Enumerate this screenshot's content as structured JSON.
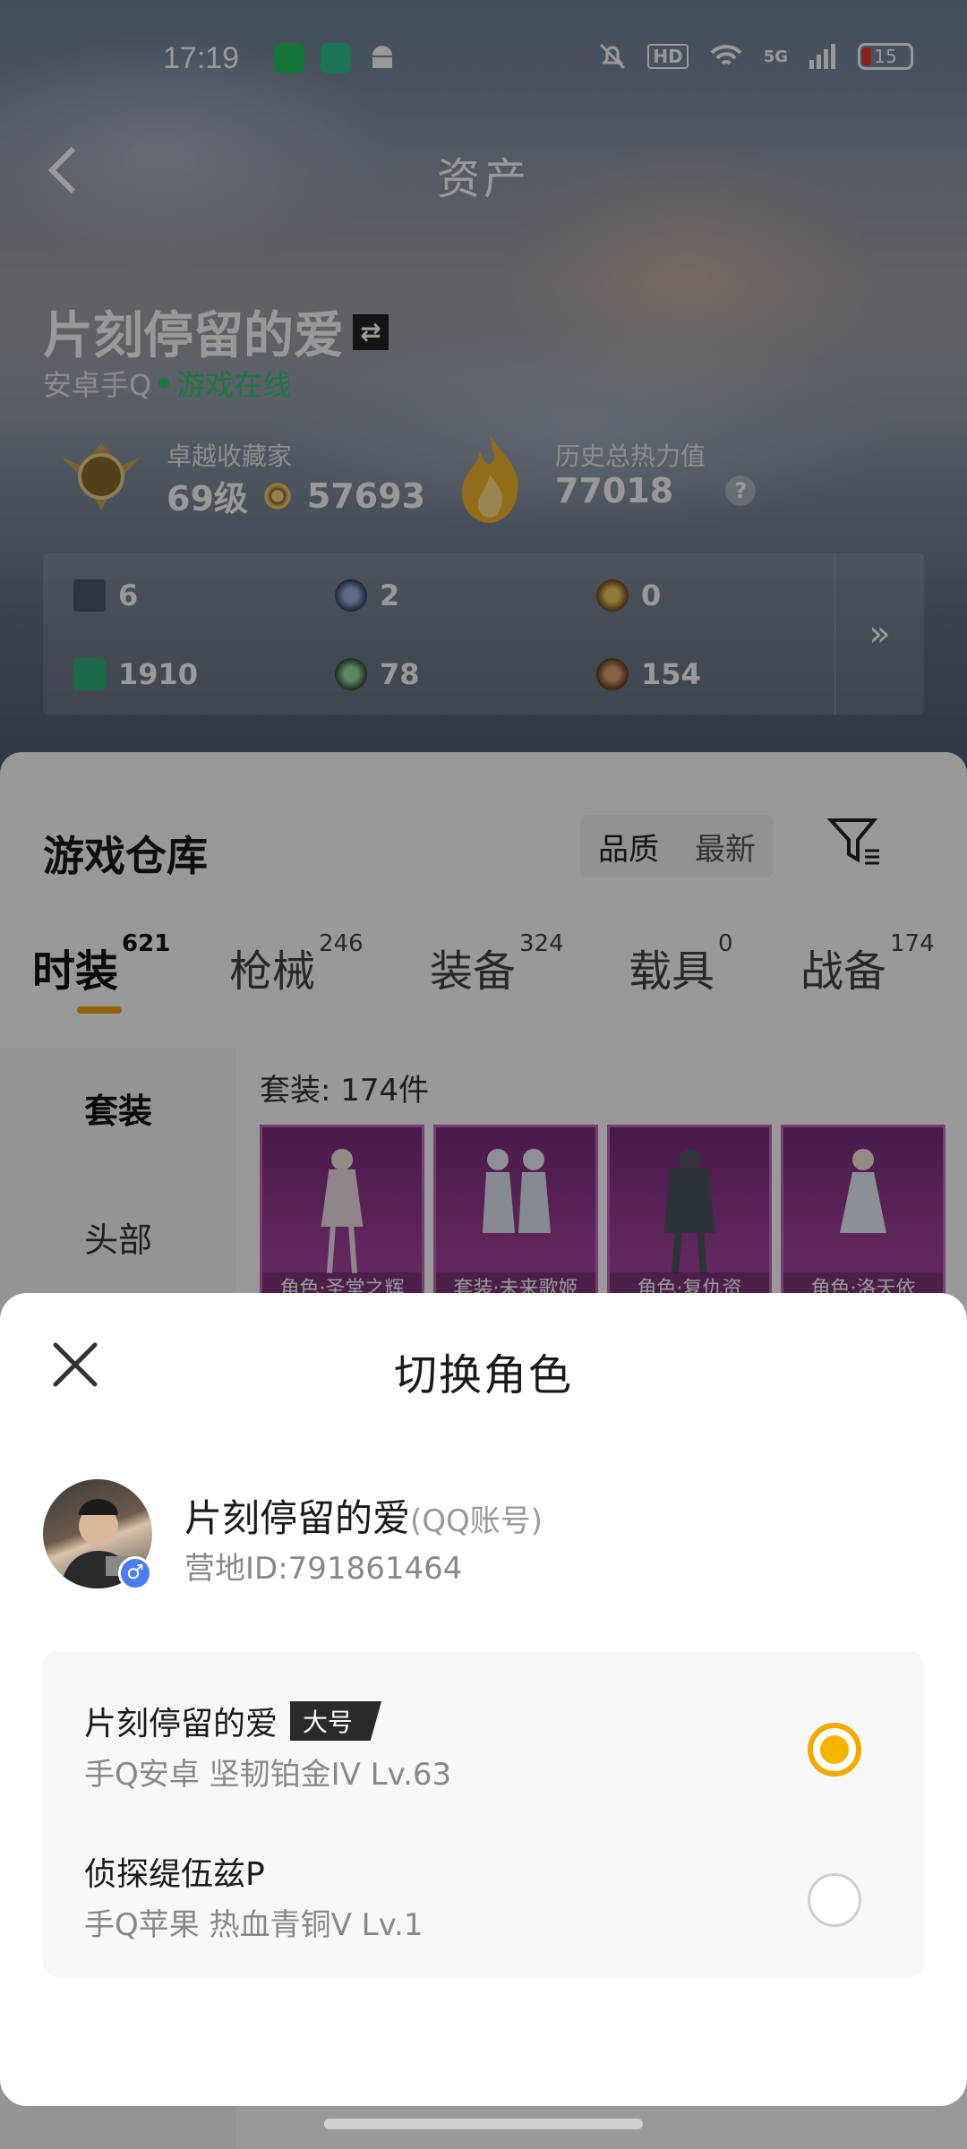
{
  "status_bar": {
    "time": "17:19",
    "hd": "HD",
    "network": "5G",
    "battery": "15"
  },
  "header": {
    "title": "资产"
  },
  "profile": {
    "name": "片刻停留的爱",
    "platform": "安卓手Q",
    "online_status": "游戏在线",
    "collector": {
      "label": "卓越收藏家",
      "level": "69级",
      "points": "57693"
    },
    "heat": {
      "label": "历史总热力值",
      "value": "77018",
      "help": "?"
    }
  },
  "resources": [
    {
      "icon": "card-icon",
      "value": "6"
    },
    {
      "icon": "blue-coin-icon",
      "value": "2"
    },
    {
      "icon": "gold-coin-icon",
      "value": "0"
    },
    {
      "icon": "green-card-icon",
      "value": "1910"
    },
    {
      "icon": "green-coin-icon",
      "value": "78"
    },
    {
      "icon": "bronze-coin-icon",
      "value": "154"
    }
  ],
  "warehouse": {
    "title": "游戏仓库",
    "sort_options": [
      "品质",
      "最新"
    ],
    "tabs": [
      {
        "label": "时装",
        "count": "621",
        "active": true
      },
      {
        "label": "枪械",
        "count": "246",
        "active": false
      },
      {
        "label": "装备",
        "count": "324",
        "active": false
      },
      {
        "label": "载具",
        "count": "0",
        "active": false
      },
      {
        "label": "战备",
        "count": "174",
        "active": false
      }
    ],
    "categories": [
      "套装",
      "头部"
    ],
    "suit_count": "套装: 174件",
    "cards": [
      "角色·圣堂之辉",
      "套装·未来歌姬",
      "角色·复仇资",
      "角色·洛天依"
    ]
  },
  "modal": {
    "title": "切换角色",
    "account": {
      "name": "片刻停留的爱",
      "account_type": "(QQ账号)",
      "camp_id": "营地ID:791861464"
    },
    "roles": [
      {
        "name": "片刻停留的爱",
        "tag": "大号",
        "detail": "手Q安卓  坚韧铂金IV  Lv.63",
        "selected": true
      },
      {
        "name": "侦探缇伍兹P",
        "tag": "",
        "detail": "手Q苹果  热血青铜V  Lv.1",
        "selected": false
      }
    ]
  },
  "colors": {
    "accent": "#f5a800",
    "online": "#28c76f",
    "card": "#9a3a96"
  }
}
